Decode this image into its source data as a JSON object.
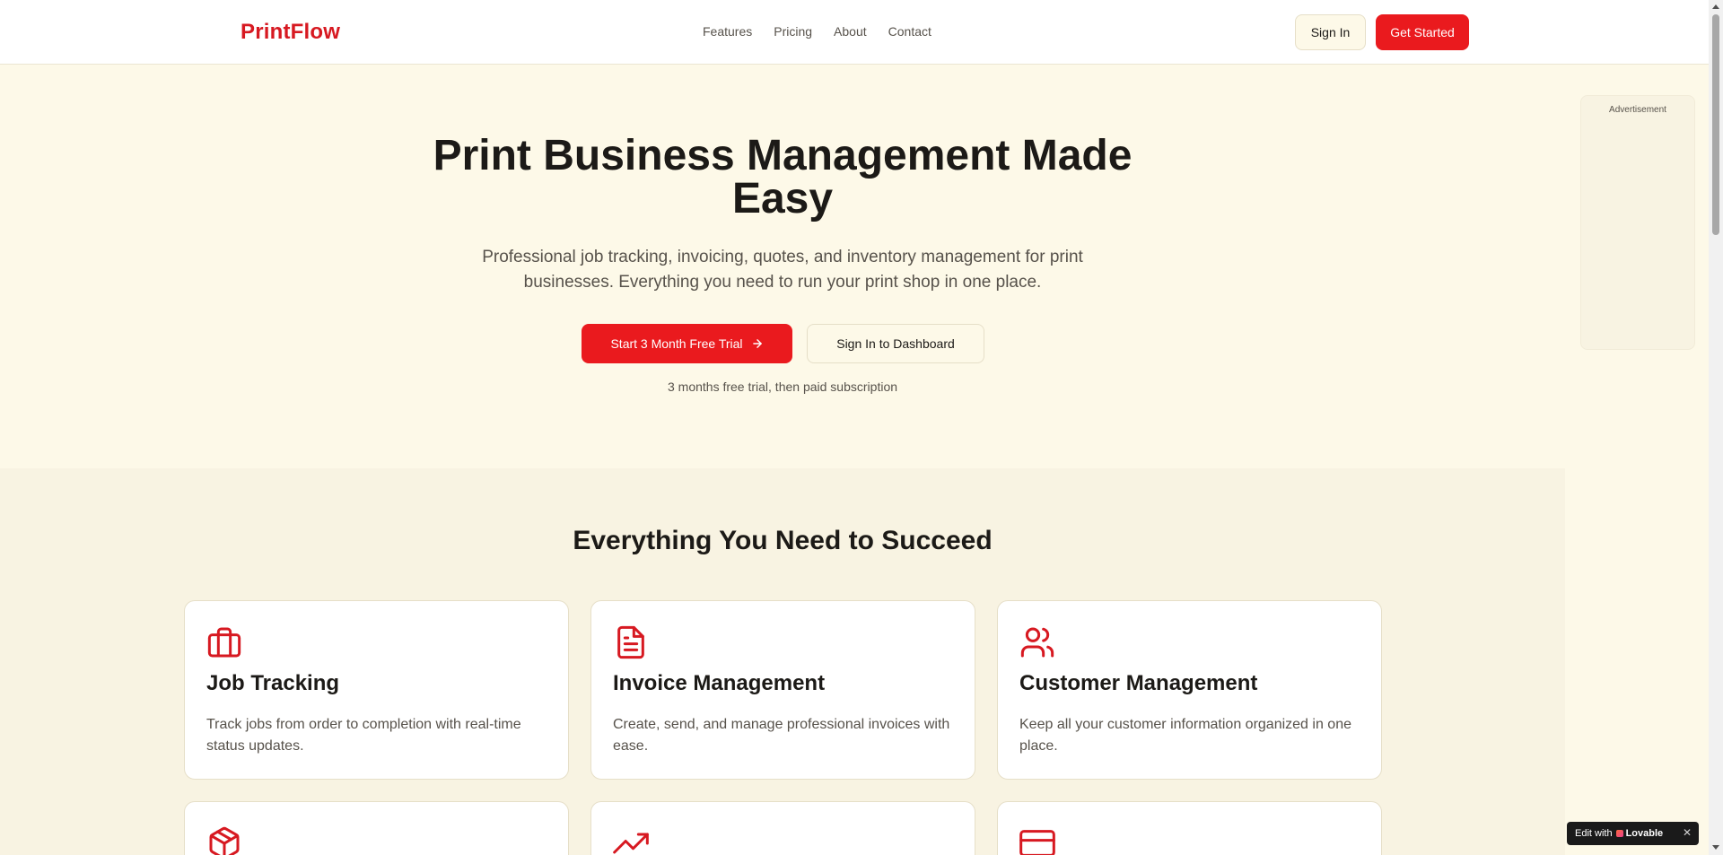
{
  "header": {
    "logo": "PrintFlow",
    "nav": [
      "Features",
      "Pricing",
      "About",
      "Contact"
    ],
    "sign_in": "Sign In",
    "get_started": "Get Started"
  },
  "hero": {
    "title_line1": "Print Business Management Made",
    "title_line2": "Easy",
    "subtitle": "Professional job tracking, invoicing, quotes, and inventory management for print businesses. Everything you need to run your print shop in one place.",
    "primary_cta": "Start 3 Month Free Trial",
    "secondary_cta": "Sign In to Dashboard",
    "note": "3 months free trial, then paid subscription"
  },
  "ad": {
    "label": "Advertisement"
  },
  "features": {
    "title": "Everything You Need to Succeed",
    "cards": [
      {
        "icon": "briefcase-icon",
        "title": "Job Tracking",
        "text": "Track jobs from order to completion with real-time status updates."
      },
      {
        "icon": "file-text-icon",
        "title": "Invoice Management",
        "text": "Create, send, and manage professional invoices with ease."
      },
      {
        "icon": "users-icon",
        "title": "Customer Management",
        "text": "Keep all your customer information organized in one place."
      },
      {
        "icon": "package-icon"
      },
      {
        "icon": "trending-up-icon"
      },
      {
        "icon": "credit-card-icon"
      }
    ]
  },
  "badge": {
    "prefix": "Edit with",
    "brand": "Lovable",
    "close": "✕"
  },
  "colors": {
    "accent": "#ea1a1e",
    "logo": "#d71921",
    "hero_bg": "#fdf9e8",
    "section_bg": "#f8f3e2"
  }
}
